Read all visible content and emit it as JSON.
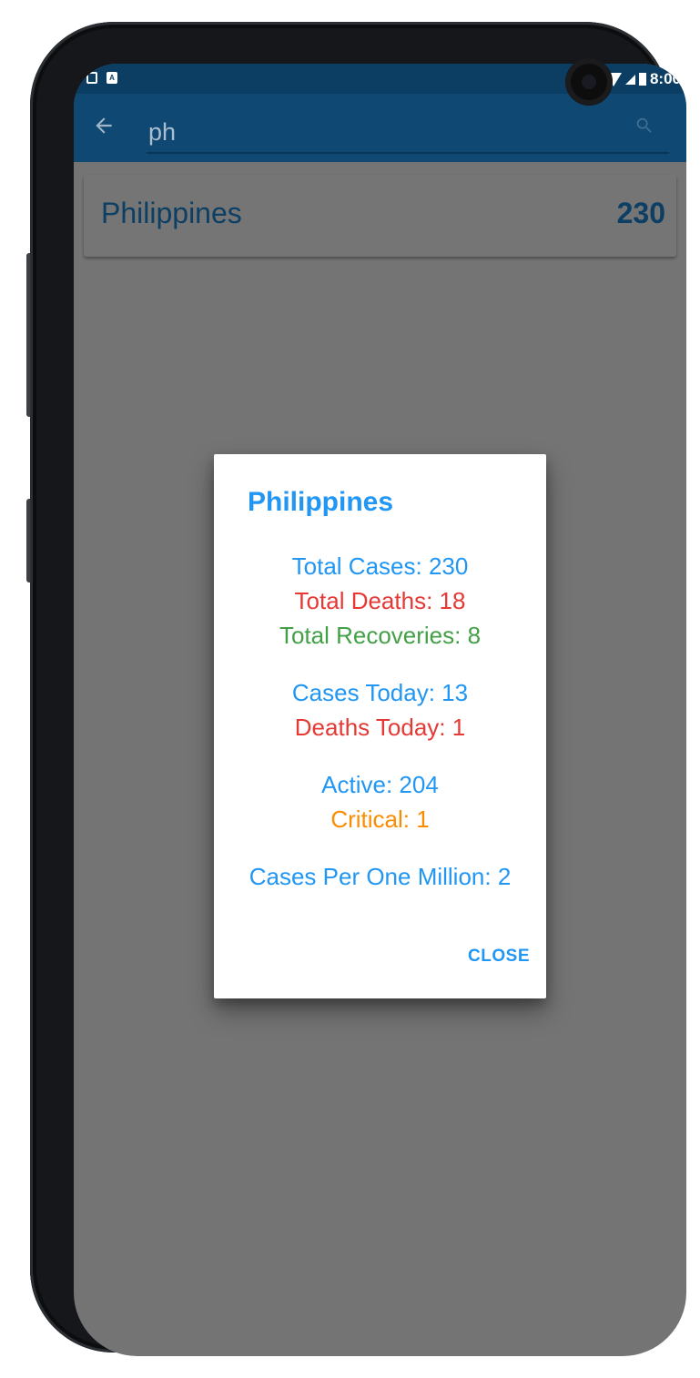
{
  "status_bar": {
    "time": "8:00"
  },
  "search": {
    "query": "ph"
  },
  "results": [
    {
      "country": "Philippines",
      "cases": "230"
    }
  ],
  "dialog": {
    "title": "Philippines",
    "total_cases": "Total Cases: 230",
    "total_deaths": "Total Deaths: 18",
    "total_recoveries": "Total Recoveries: 8",
    "cases_today": "Cases Today: 13",
    "deaths_today": "Deaths Today: 1",
    "active": "Active: 204",
    "critical": "Critical: 1",
    "cases_per_million": "Cases Per One Million: 2",
    "close_label": "CLOSE"
  },
  "colors": {
    "app_bar": "#0f4873",
    "accent_blue": "#2196f3",
    "red": "#e53935",
    "green": "#43a047",
    "orange": "#fb8c00",
    "scrim": "#747474"
  }
}
